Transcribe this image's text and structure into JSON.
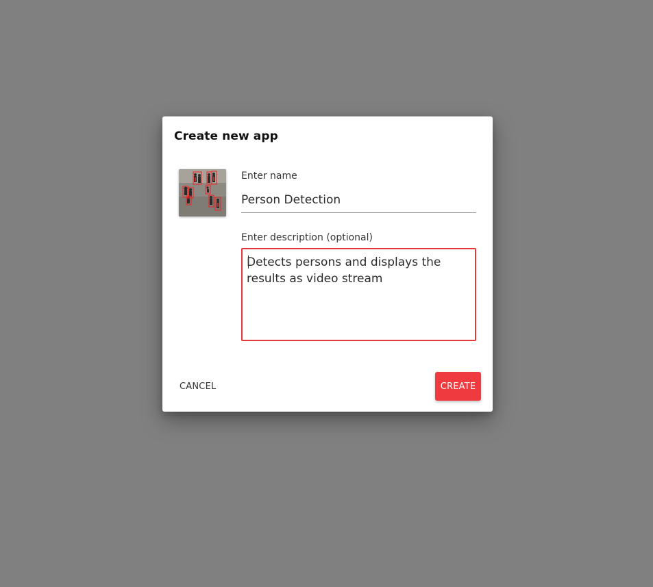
{
  "dialog": {
    "title": "Create new app",
    "name_label": "Enter name",
    "name_value": "Person Detection",
    "description_label": "Enter description (optional)",
    "description_value": "Detects persons and displays the results as video stream",
    "cancel_label": "CANCEL",
    "create_label": "CREATE",
    "thumbnail_icon": "person-detection-thumbnail"
  },
  "colors": {
    "backdrop": "#808080",
    "accent": "#ef3b3f",
    "focus_border": "#e5383b"
  }
}
